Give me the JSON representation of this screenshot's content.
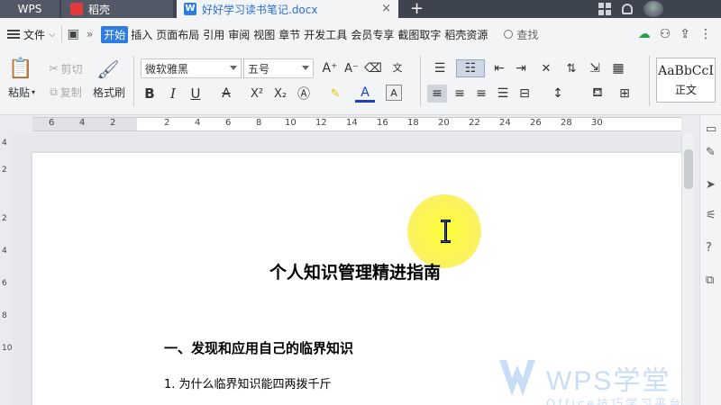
{
  "tabs": {
    "wps": "WPS",
    "daoke": "稻壳",
    "doc": "好好学习读书笔记.docx",
    "close": "×",
    "new_tab": "+"
  },
  "menubar": {
    "file": "文件",
    "items": [
      "开始",
      "插入",
      "页面布局",
      "引用",
      "审阅",
      "视图",
      "章节",
      "开发工具",
      "会员专享",
      "截图取字",
      "稻壳资源"
    ],
    "search": "查找"
  },
  "ribbon": {
    "paste": "粘贴",
    "cut": "剪切",
    "copy": "复制",
    "format_painter": "格式刷",
    "font_name": "微软雅黑",
    "font_size": "五号",
    "bold": "B",
    "italic": "I",
    "underline": "U",
    "style_sample": "AaBbCcI",
    "style_name": "正文"
  },
  "ruler": {
    "numbers": [
      "6",
      "4",
      "2",
      "2",
      "4",
      "6",
      "8",
      "10",
      "12",
      "14",
      "16",
      "18",
      "20",
      "22",
      "24",
      "26",
      "28",
      "30"
    ]
  },
  "vruler": {
    "numbers": [
      "4",
      "2",
      "2",
      "4",
      "6",
      "8",
      "10"
    ]
  },
  "document": {
    "title": "个人知识管理精进指南",
    "heading1": "一、发现和应用自己的临界知识",
    "item1": "1.  为什么临界知识能四两拨千斤"
  },
  "watermark": {
    "brand": "WPS学堂",
    "sub": "Office技巧学习平台"
  },
  "colors": {
    "accent": "#2f7de1",
    "tabbar": "#3e4350",
    "highlight_halo": "#ffff3a"
  }
}
